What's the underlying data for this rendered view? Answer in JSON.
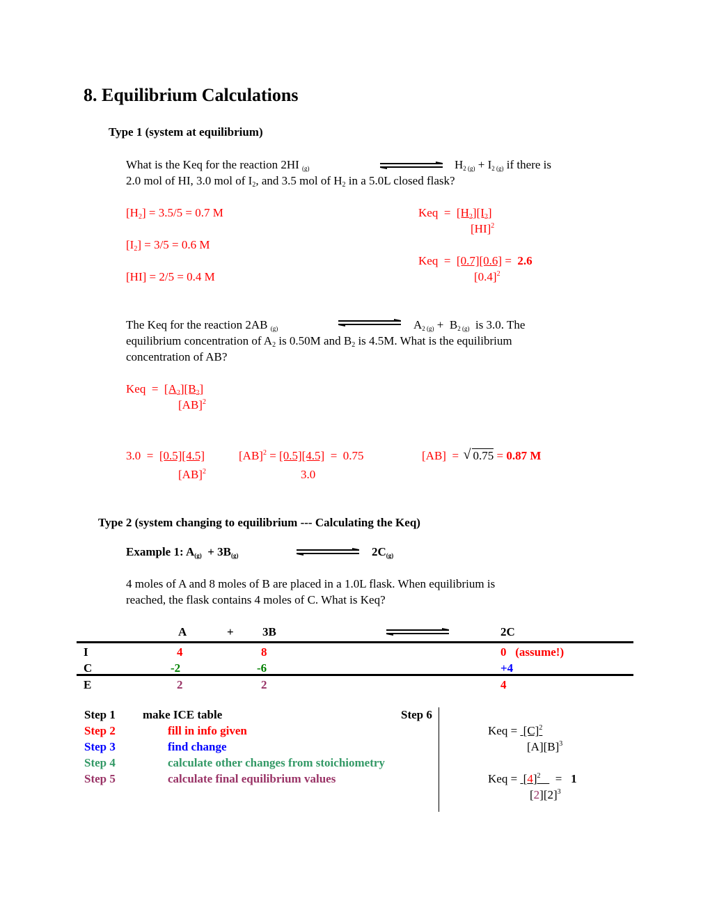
{
  "title": "8. Equilibrium Calculations",
  "type1": {
    "heading": "Type 1 (system at equilibrium)",
    "problem1": {
      "q_line1_pre": "What is the Keq for the reaction 2HI",
      "q_line1_state": "(g)",
      "q_products": {
        "h": "H",
        "h_sub": "2 (g)",
        "plus": "+",
        "i": "I",
        "i_sub": "2 (g)",
        "post": "if there is"
      },
      "q_line2": {
        "p1": "2.0 mol of HI, 3.0 mol of I",
        "s1": "2",
        "p2": ", and 3.5 mol of H",
        "s2": "2",
        "p3": " in a 5.0L closed flask?"
      },
      "calc": {
        "h2": {
          "open": "[H",
          "sub": "2",
          "rest": "] =  3.5/5 = 0.7 M"
        },
        "i2": {
          "open": "[I",
          "sub": "2",
          "rest": "] = 3/5 = 0.6 M"
        },
        "hi": "[HI] = 2/5 = 0.4 M",
        "keq_expr": {
          "lhs": "Keq  =  ",
          "num_a": "[H",
          "num_a_sub": "2",
          "num_b": "][I",
          "num_b_sub": "2",
          "num_c": "]",
          "den": "[HI]",
          "den_exp": "2"
        },
        "keq_val": {
          "lhs": "Keq  =  ",
          "num": "[0.7][0.6]",
          "eq": " =  ",
          "result": "2.6",
          "den": "[0.4]",
          "den_exp": "2"
        }
      }
    },
    "problem2": {
      "line1": {
        "pre": "The Keq for the reaction  2AB",
        "state": "(g)",
        "a": "A",
        "a_sub": "2 (g)",
        "plus": " +  B",
        "b_sub": "2 (g)",
        "post": "  is 3.0. The"
      },
      "line2": {
        "p1": "equilibrium concentration of A",
        "s1": "2",
        "p2": " is 0.50M and B",
        "s2": "2",
        "p3": " is 4.5M. What is the equilibrium"
      },
      "line3": "concentration of AB?",
      "keq_expr": {
        "lhs": "Keq  =  ",
        "n1": "[A",
        "n1s": "2",
        "n2": "][B",
        "n2s": "2",
        "n3": "]",
        "den": "[AB]",
        "den_exp": "2"
      },
      "solve": {
        "s1_lhs": "3.0  =  ",
        "s1_num": "[0.5][4.5]",
        "s1_den": "[AB]",
        "s1_den_exp": "2",
        "s2_lhs": "[AB]",
        "s2_lhs_exp": "2",
        "s2_eq": " = ",
        "s2_num": "[0.5][4.5]",
        "s2_rhs": "  =  0.75",
        "s2_den": "3.0",
        "s3_lhs": "[AB]  =  ",
        "s3_rad": "0.75",
        "s3_eq": " = ",
        "s3_result": "0.87 M"
      }
    }
  },
  "type2": {
    "heading": "Type 2 (system changing to equilibrium --- Calculating the Keq)",
    "example": {
      "label": "Example 1:  A",
      "a_state": "(g)",
      "mid": "  + 3B",
      "b_state": "(g)",
      "prod": "2C",
      "c_state": "(g)"
    },
    "problem_line1": "4 moles of A and 8 moles of B are placed in a 1.0L flask. When equilibrium is",
    "problem_line2": "reached, the flask contains 4 moles of C. What is Keq?",
    "ice_table": {
      "header": {
        "a": "A",
        "plus": "+",
        "b": "3B",
        "c": "2C"
      },
      "rows": [
        {
          "label": "I",
          "a": "4",
          "b": "8",
          "c": "0   (assume!)"
        },
        {
          "label": "C",
          "a": "-2",
          "b": "-6",
          "c": "+4"
        },
        {
          "label": "E",
          "a": "2",
          "b": "2",
          "c": "4"
        }
      ]
    },
    "steps": [
      {
        "step": "Step 1",
        "desc": "make ICE table",
        "color": "#000000"
      },
      {
        "step": "Step 2",
        "desc": "fill in info given",
        "color": "#ff0000"
      },
      {
        "step": "Step 3",
        "desc": "find change",
        "color": "#0000ff"
      },
      {
        "step": "Step 4",
        "desc": "calculate other changes from stoichiometry",
        "color": "#339966"
      },
      {
        "step": "Step 5",
        "desc": "calculate final equilibrium values",
        "color": "#993366"
      }
    ],
    "step6": {
      "label": "Step 6",
      "keq_expr": {
        "lhs": "Keq = ",
        "num": "[C]",
        "num_exp": "2",
        "den": "[A][B]",
        "den_exp": "3"
      },
      "keq_val": {
        "lhs": "Keq = ",
        "num_open": "[",
        "num_val": "4",
        "num_close": "]",
        "num_exp": "2",
        "eq": "  =   ",
        "result": "1",
        "den_open": "[",
        "den_val": "2",
        "den_rest": "][2]",
        "den_exp": "3"
      }
    }
  },
  "colors": {
    "red": "#ff0000",
    "blue": "#0000ff",
    "green": "#008000",
    "step4_green": "#339966",
    "plum": "#993366"
  }
}
